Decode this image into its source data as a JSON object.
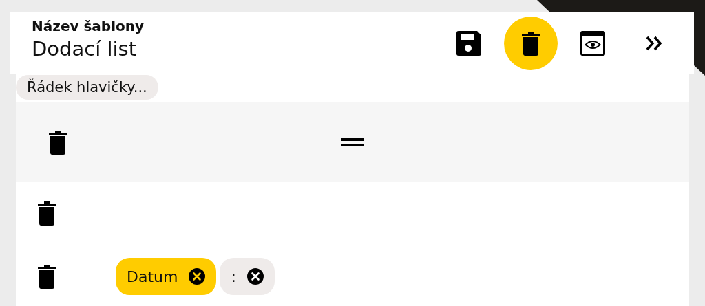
{
  "header": {
    "label": "Název šablony",
    "value": "Dodací list",
    "actions": [
      {
        "kind": "save",
        "highlighted": false
      },
      {
        "kind": "delete",
        "highlighted": true
      },
      {
        "kind": "preview",
        "highlighted": false
      },
      {
        "kind": "expand",
        "highlighted": false
      }
    ]
  },
  "section": {
    "chip": "Řádek hlavičky..."
  },
  "rows": [
    {
      "kind": "handle",
      "chips": []
    },
    {
      "kind": "plain",
      "chips": []
    },
    {
      "kind": "plain",
      "chips": [
        {
          "label": "Datum",
          "kind": "field"
        },
        {
          "label": ":",
          "kind": "text"
        }
      ]
    }
  ]
}
